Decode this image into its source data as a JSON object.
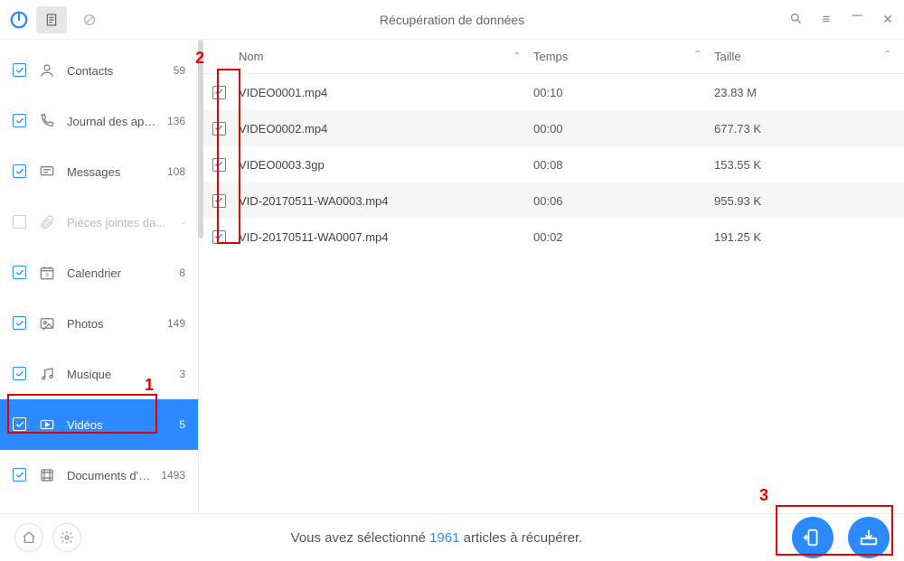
{
  "window": {
    "title": "Récupération de données"
  },
  "sidebar": {
    "items": [
      {
        "key": "contacts",
        "label": "Contacts",
        "count": "59",
        "checked": true,
        "disabled": false
      },
      {
        "key": "calllog",
        "label": "Journal des appels",
        "count": "136",
        "checked": true,
        "disabled": false
      },
      {
        "key": "messages",
        "label": "Messages",
        "count": "108",
        "checked": true,
        "disabled": false
      },
      {
        "key": "attach",
        "label": "Pièces jointes da...",
        "count": "-",
        "checked": false,
        "disabled": true
      },
      {
        "key": "calendar",
        "label": "Calendrier",
        "count": "8",
        "checked": true,
        "disabled": false
      },
      {
        "key": "photos",
        "label": "Photos",
        "count": "149",
        "checked": true,
        "disabled": false
      },
      {
        "key": "music",
        "label": "Musique",
        "count": "3",
        "checked": true,
        "disabled": false
      },
      {
        "key": "videos",
        "label": "Vidéos",
        "count": "5",
        "checked": true,
        "disabled": false,
        "selected": true
      },
      {
        "key": "appdocs",
        "label": "Documents d'App",
        "count": "1493",
        "checked": true,
        "disabled": false
      }
    ]
  },
  "columns": {
    "name": "Nom",
    "time": "Temps",
    "size": "Taille"
  },
  "rows": [
    {
      "name": "VIDEO0001.mp4",
      "time": "00:10",
      "size": "23.83 M",
      "checked": true
    },
    {
      "name": "VIDEO0002.mp4",
      "time": "00:00",
      "size": "677.73 K",
      "checked": true
    },
    {
      "name": "VIDEO0003.3gp",
      "time": "00:08",
      "size": "153.55 K",
      "checked": true
    },
    {
      "name": "VID-20170511-WA0003.mp4",
      "time": "00:06",
      "size": "955.93 K",
      "checked": true
    },
    {
      "name": "VID-20170511-WA0007.mp4",
      "time": "00:02",
      "size": "191.25 K",
      "checked": true
    }
  ],
  "footer": {
    "prefix": "Vous avez sélectionné ",
    "count": "1961",
    "suffix": " articles à récupérer."
  },
  "annotations": {
    "label1": "1",
    "label2": "2",
    "label3": "3"
  }
}
